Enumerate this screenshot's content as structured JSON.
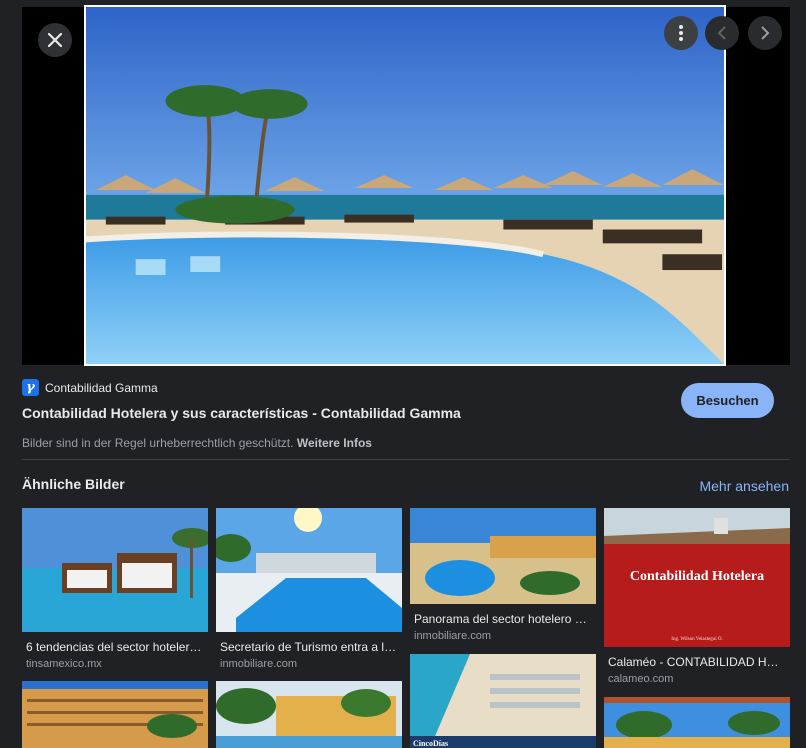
{
  "viewer": {
    "close_icon": "close-icon",
    "more_icon": "more-vert-icon",
    "prev_icon": "chevron-left-icon",
    "next_icon": "chevron-right-icon"
  },
  "source": {
    "favicon_char": "γ",
    "name": "Contabilidad Gamma",
    "title": "Contabilidad Hotelera y sus características - Contabilidad Gamma",
    "visit_label": "Besuchen"
  },
  "copyright": {
    "text": "Bilder sind in der Regel urheberrechtlich geschützt.",
    "link": "Weitere Infos"
  },
  "similar": {
    "heading": "Ähnliche Bilder",
    "more_label": "Mehr ansehen",
    "cards": [
      {
        "title": "6 tendencias del sector hoteler…",
        "domain": "tinsamexico.mx"
      },
      {
        "title": "Secretario de Turismo entra a l…",
        "domain": "inmobiliare.com"
      },
      {
        "title": "Panorama del sector hotelero …",
        "domain": "inmobiliare.com"
      },
      {
        "title": "Calaméo - CONTABILIDAD HO…",
        "domain": "calameo.com",
        "image_text": "Contabilidad Hotelera",
        "image_caption": "Ing. Wilson Velasteguí O."
      },
      {
        "title": "",
        "domain": "",
        "image_text": "CincoDías"
      }
    ]
  },
  "colors": {
    "accent": "#8ab4f8",
    "background": "#202124"
  }
}
